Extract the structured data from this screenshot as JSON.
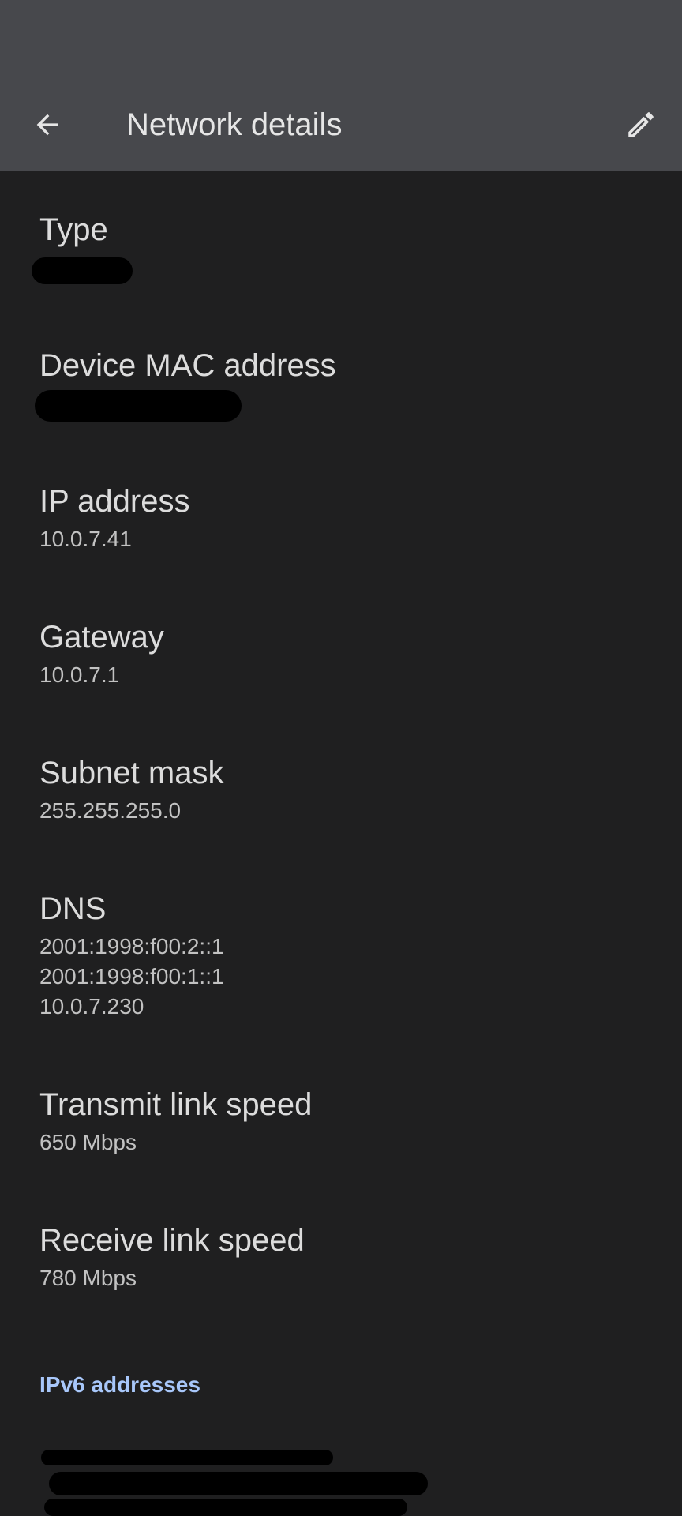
{
  "app_bar": {
    "title": "Network details",
    "back_icon": "arrow-left-icon",
    "edit_icon": "pencil-icon"
  },
  "details": [
    {
      "label": "Type",
      "value": ""
    },
    {
      "label": "Device MAC address",
      "value": ""
    },
    {
      "label": "IP address",
      "value": "10.0.7.41"
    },
    {
      "label": "Gateway",
      "value": "10.0.7.1"
    },
    {
      "label": "Subnet mask",
      "value": "255.255.255.0"
    },
    {
      "label": "DNS",
      "value": "2001:1998:f00:2::1\n2001:1998:f00:1::1\n10.0.7.230"
    },
    {
      "label": "Transmit link speed",
      "value": "650 Mbps"
    },
    {
      "label": "Receive link speed",
      "value": "780 Mbps"
    }
  ],
  "ipv6": {
    "header": "IPv6 addresses"
  },
  "colors": {
    "appbar_bg": "#47484c",
    "page_bg": "#1f1f20",
    "accent": "#a8c7fa"
  }
}
